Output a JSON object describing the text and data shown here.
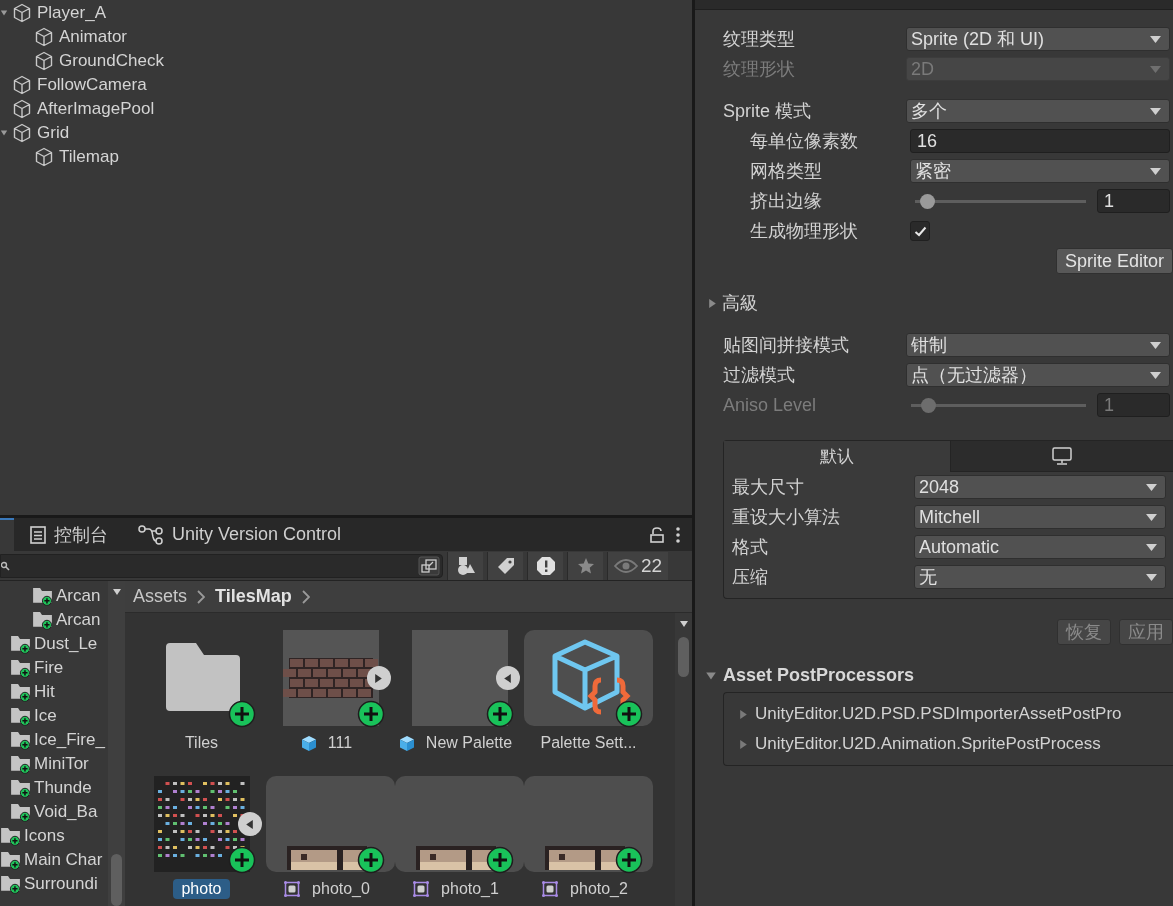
{
  "hierarchy": {
    "items": [
      {
        "label": "Player_A",
        "expanded": true,
        "children": [
          {
            "label": "Animator"
          },
          {
            "label": "GroundCheck"
          }
        ]
      },
      {
        "label": "FollowCamera"
      },
      {
        "label": "AfterImagePool"
      },
      {
        "label": "Grid",
        "expanded": true,
        "children": [
          {
            "label": "Tilemap"
          }
        ]
      }
    ]
  },
  "project": {
    "tabs": [
      {
        "kind": "stub",
        "selected": true
      },
      {
        "kind": "console",
        "label": "控制台",
        "selected": false
      },
      {
        "kind": "version-control",
        "label": "Unity Version Control",
        "selected": false
      }
    ],
    "toolbar": {
      "hidden_count": "22"
    },
    "folder_tree": [
      {
        "children": [
          {
            "children": [
              {
                "label": "Arcan"
              },
              {
                "label": "Arcan"
              }
            ]
          },
          {
            "label": "Dust_Le"
          },
          {
            "label": "Fire"
          },
          {
            "label": "Hit"
          },
          {
            "label": "Ice"
          },
          {
            "label": "Ice_Fire_"
          },
          {
            "label": "MiniTor"
          },
          {
            "label": "Thunde"
          },
          {
            "label": "Void_Ba"
          }
        ]
      },
      {
        "label": "Icons"
      },
      {
        "label": "Main Char"
      },
      {
        "label": "Surroundi"
      }
    ],
    "breadcrumb": [
      {
        "label": "Assets",
        "current": false
      },
      {
        "label": "TilesMap",
        "current": true
      }
    ],
    "assets": [
      {
        "name": "Tiles",
        "kind": "folder",
        "in_group": false,
        "selected": false
      },
      {
        "name": "111",
        "kind": "palette",
        "preview": true,
        "expanded": false,
        "in_group": false,
        "selected": false
      },
      {
        "name": "New Palette",
        "kind": "palette",
        "preview": false,
        "expanded": true,
        "in_group": false,
        "selected": false
      },
      {
        "name": "Palette Sett...",
        "kind": "script",
        "in_group": true,
        "selected": false
      },
      {
        "name": "photo",
        "kind": "texture",
        "expanded": true,
        "in_group": false,
        "selected": true
      },
      {
        "name": "photo_0",
        "kind": "sprite",
        "in_group": true,
        "selected": false
      },
      {
        "name": "photo_1",
        "kind": "sprite",
        "in_group": true,
        "selected": false
      },
      {
        "name": "photo_2",
        "kind": "sprite",
        "in_group": true,
        "selected": false
      }
    ]
  },
  "inspector": {
    "sections": [
      {
        "rows": [
          {
            "kind": "dropdown",
            "label": "纹理类型",
            "value": "Sprite (2D 和 UI)",
            "disabled": false
          },
          {
            "kind": "dropdown",
            "label": "纹理形状",
            "value": "2D",
            "disabled": true
          }
        ]
      },
      {
        "rows": [
          {
            "kind": "dropdown",
            "label": "Sprite 模式",
            "value": "多个",
            "disabled": false,
            "children": [
              {
                "kind": "number",
                "label": "每单位像素数",
                "value": "16"
              },
              {
                "kind": "dropdown",
                "label": "网格类型",
                "value": "紧密",
                "disabled": false
              },
              {
                "kind": "slider",
                "label": "挤出边缘",
                "level": 0.03,
                "value": "1",
                "disabled": false
              },
              {
                "kind": "checkbox",
                "label": "生成物理形状",
                "checked": true
              },
              {
                "kind": "button",
                "label": "Sprite Editor"
              }
            ]
          }
        ]
      },
      {
        "rows": [
          {
            "kind": "foldout",
            "label": "高級",
            "expanded": false
          }
        ]
      },
      {
        "rows": [
          {
            "kind": "dropdown",
            "label": "贴图间拼接模式",
            "value": "钳制",
            "disabled": false
          },
          {
            "kind": "dropdown",
            "label": "过滤模式",
            "value": "点（无过滤器）",
            "disabled": false
          },
          {
            "kind": "slider",
            "label": "Aniso Level",
            "level": 0.06,
            "value": "1",
            "disabled": true
          }
        ]
      }
    ],
    "platform": {
      "tabs": [
        {
          "kind": "text",
          "label": "默认",
          "selected": true
        },
        {
          "kind": "monitor",
          "selected": false
        }
      ],
      "rows": [
        {
          "label": "最大尺寸",
          "value": "2048"
        },
        {
          "label": "重设大小算法",
          "value": "Mitchell"
        },
        {
          "label": "格式",
          "value": "Automatic"
        },
        {
          "label": "压缩",
          "value": "无"
        }
      ]
    },
    "actions": [
      {
        "label": "恢复",
        "disabled": true
      },
      {
        "label": "应用",
        "disabled": true
      }
    ],
    "post_processors": {
      "label": "Asset PostProcessors",
      "expanded": true,
      "items": [
        {
          "label": "UnityEditor.U2D.PSD.PSDImporterAssetPostPro",
          "expanded": false
        },
        {
          "label": "UnityEditor.U2D.Animation.SpritePostProcess",
          "expanded": false
        }
      ]
    }
  }
}
